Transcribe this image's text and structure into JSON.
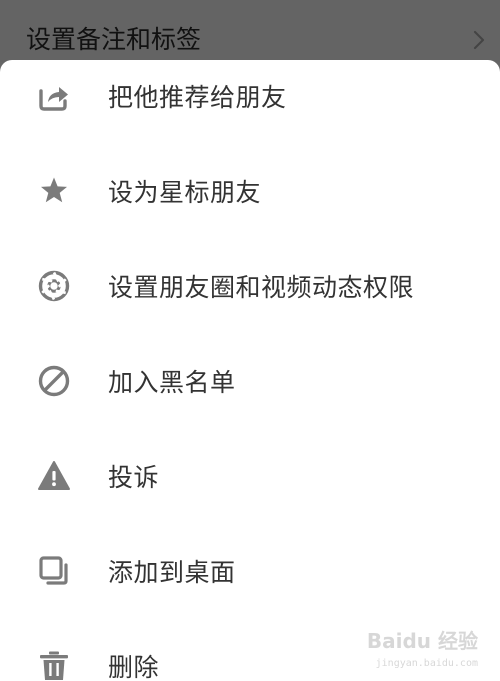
{
  "background": {
    "title": "设置备注和标签",
    "chevron_icon": "chevron-right-icon"
  },
  "sheet": {
    "items": [
      {
        "label": "把他推荐给朋友",
        "icon": "share-icon"
      },
      {
        "label": "设为星标朋友",
        "icon": "star-icon"
      },
      {
        "label": "设置朋友圈和视频动态权限",
        "icon": "aperture-icon"
      },
      {
        "label": "加入黑名单",
        "icon": "block-icon"
      },
      {
        "label": "投诉",
        "icon": "warning-icon"
      },
      {
        "label": "添加到桌面",
        "icon": "add-to-desktop-icon"
      },
      {
        "label": "删除",
        "icon": "trash-icon"
      }
    ]
  },
  "watermark": {
    "text": "Baidu 经验",
    "url_text": "jingyan.baidu.com"
  },
  "colors": {
    "icon": "#7b7b7b",
    "text": "#333333",
    "overlay": "#666666",
    "sheet": "#ffffff"
  }
}
